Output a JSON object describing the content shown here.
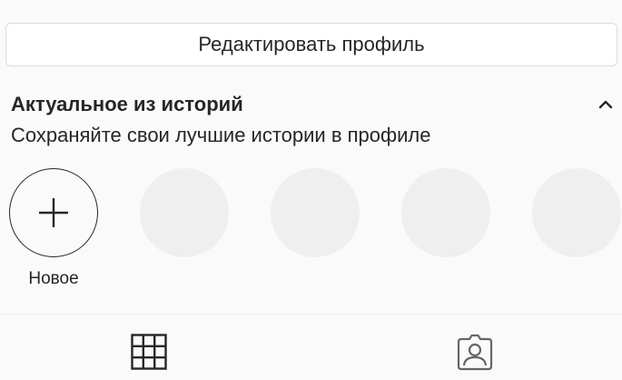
{
  "profile": {
    "edit_button_label": "Редактировать профиль"
  },
  "highlights": {
    "title": "Актуальное из историй",
    "subtitle": "Сохраняйте свои лучшие истории в профиле",
    "collapse_icon": "chevron-up-icon",
    "new_label": "Новое",
    "new_icon": "plus-icon",
    "placeholder_count": 4
  },
  "tabs": [
    {
      "name": "grid",
      "icon": "grid-icon"
    },
    {
      "name": "tagged",
      "icon": "tagged-person-icon"
    }
  ],
  "colors": {
    "background": "#fafafa",
    "text": "#262626",
    "border": "#dbdbdb",
    "placeholder": "#efefef"
  }
}
